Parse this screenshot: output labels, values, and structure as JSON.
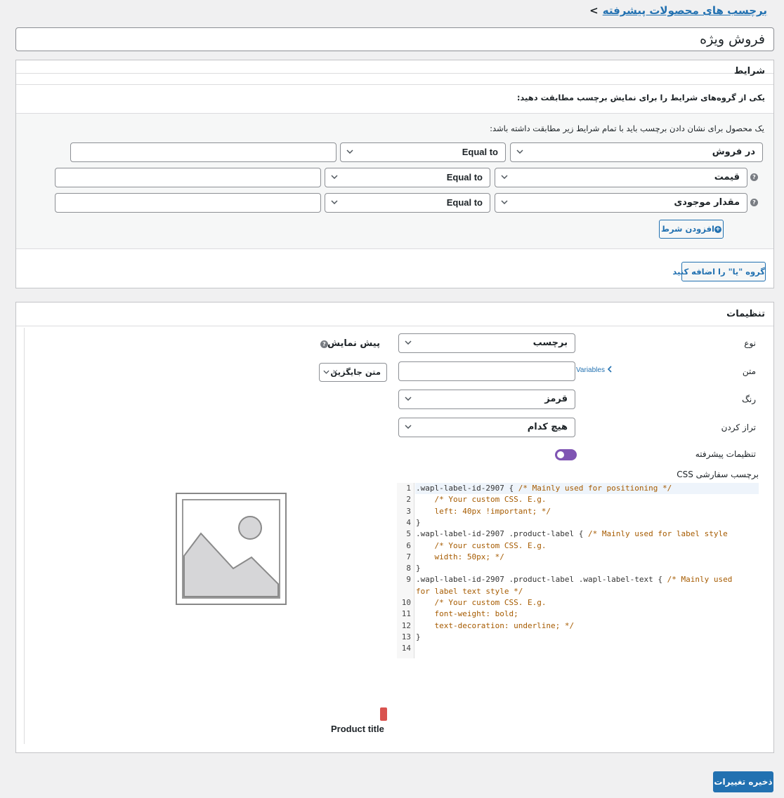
{
  "breadcrumb": {
    "link": "برچسب های محصولات پیشرفته",
    "separator": ">"
  },
  "title_value": "فروش ویژه",
  "conditions": {
    "heading": "شرایط",
    "subheading": "یکی از گروه‌های شرایط را برای نمایش برچسب مطابقت دهید:",
    "group_intro": "یک محصول برای نشان دادن برچسب باید با تمام شرایط زیر مطابقت داشته باشد:",
    "rows": [
      {
        "field": "در فروش",
        "operator": "Equal to",
        "value": ""
      },
      {
        "field": "قیمت",
        "operator": "Equal to",
        "value": ""
      },
      {
        "field": "مقدار موجودی",
        "operator": "Equal to",
        "value": ""
      }
    ],
    "help_glyph": "?",
    "add_condition": "افزودن شرط",
    "add_or_group": "گروه \"یا\" را اضافه کنید"
  },
  "settings": {
    "heading": "تنظیمات",
    "type_label": "نوع",
    "type_value": "برچسب",
    "text_label": "متن",
    "text_value": "",
    "variables": "Variables",
    "color_label": "رنگ",
    "color_value": "قرمز",
    "align_label": "تراز کردن",
    "align_value": "هیچ کدام",
    "advanced_label": "تنظیمات پیشرفته",
    "custom_css_label": "برچسب سفارشی CSS",
    "preview_label": "پیش نمایش",
    "placeholder_text": "متن جایگزین",
    "product_title": "Product title"
  },
  "css_lines": [
    {
      "n": "1",
      "code": ".wapl-label-id-2907 { ",
      "cmt": "/* Mainly used for positioning */"
    },
    {
      "n": "2",
      "code": "    ",
      "cmt": "/* Your custom CSS. E.g."
    },
    {
      "n": "3",
      "code": "",
      "cmt": "    left: 40px !important; */"
    },
    {
      "n": "4",
      "code": "}",
      "cmt": ""
    },
    {
      "n": "5",
      "code": ".wapl-label-id-2907 .product-label { ",
      "cmt": "/* Mainly used for label style"
    },
    {
      "n": "6",
      "code": "    ",
      "cmt": "/* Your custom CSS. E.g."
    },
    {
      "n": "7",
      "code": "",
      "cmt": "    width: 50px; */"
    },
    {
      "n": "8",
      "code": "}",
      "cmt": ""
    },
    {
      "n": "9",
      "code": ".wapl-label-id-2907 .product-label .wapl-label-text { ",
      "cmt": "/* Mainly used"
    },
    {
      "n": "",
      "code": "",
      "cmt": "for label text style */"
    },
    {
      "n": "10",
      "code": "    ",
      "cmt": "/* Your custom CSS. E.g."
    },
    {
      "n": "11",
      "code": "",
      "cmt": "    font-weight: bold;"
    },
    {
      "n": "12",
      "code": "",
      "cmt": "    text-decoration: underline; */"
    },
    {
      "n": "13",
      "code": "}",
      "cmt": ""
    },
    {
      "n": "14",
      "code": "",
      "cmt": ""
    }
  ],
  "save_button": "ذخیره تغییرات",
  "colors": {
    "accent": "#2271b1",
    "toggle": "#7f54b3",
    "preview_badge": "#d9534f"
  }
}
